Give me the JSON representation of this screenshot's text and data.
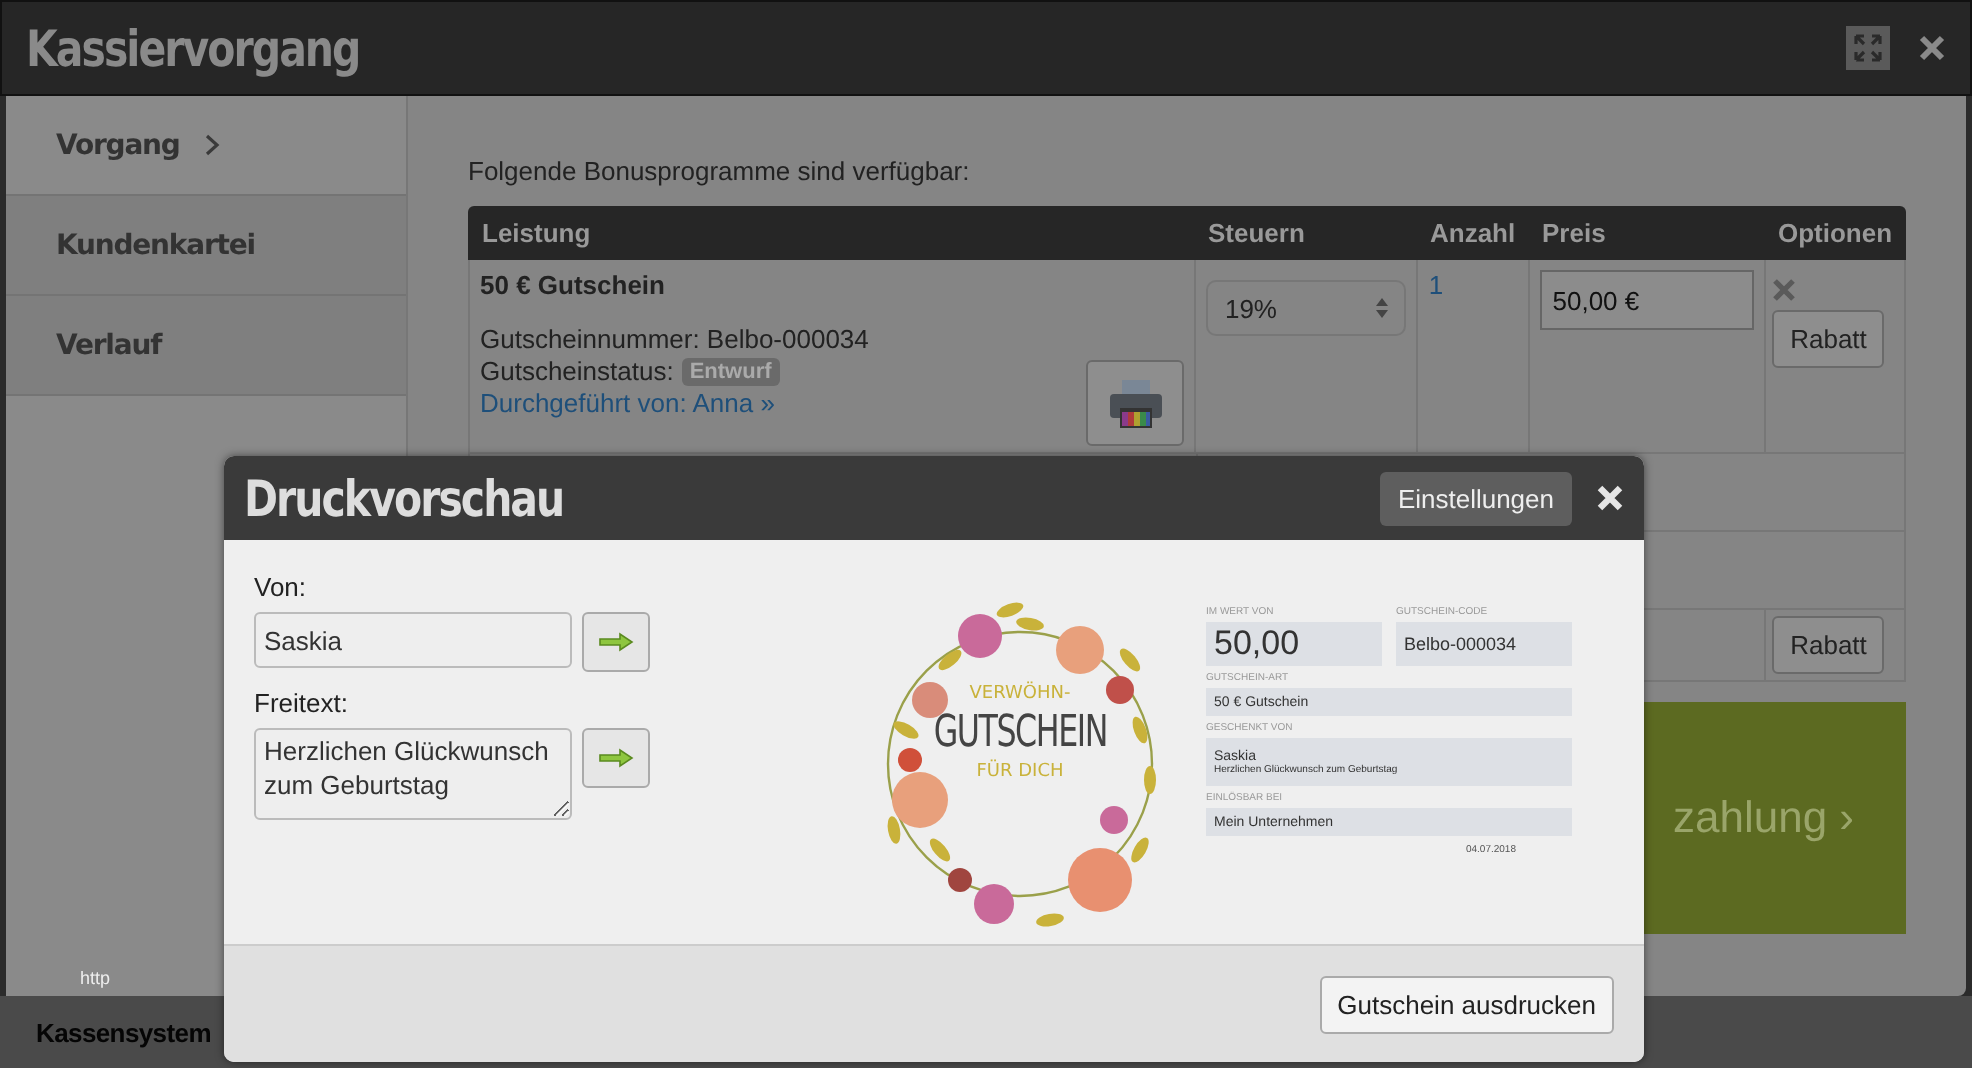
{
  "window": {
    "title": "Kassiervorgang"
  },
  "sidebar": {
    "items": [
      {
        "label": "Vorgang",
        "selected": true
      },
      {
        "label": "Kundenkartei",
        "selected": false
      },
      {
        "label": "Verlauf",
        "selected": false
      }
    ]
  },
  "intro": "Folgende Bonusprogramme sind verfügbar:",
  "table": {
    "columns": [
      "Leistung",
      "Steuern",
      "Anzahl",
      "Preis",
      "Optionen"
    ],
    "rows": [
      {
        "title": "50 € Gutschein",
        "number": "Gutscheinnummer: Belbo-000034",
        "status_label": "Gutscheinstatus:",
        "status": "Entwurf",
        "performed_by": "Durchgeführt von: Anna »",
        "tax": "19%",
        "quantity": "1",
        "price": "50,00 €",
        "discount": "Rabatt"
      },
      {
        "discount": "Rabatt"
      }
    ]
  },
  "pay_button": "zahlung ›",
  "hint": "http",
  "status_bar": "Kassensystem",
  "dialog": {
    "title": "Druckvorschau",
    "settings": "Einstellungen",
    "fields": [
      {
        "kind": "input",
        "label": "Von:",
        "value": "Saskia"
      },
      {
        "kind": "textarea",
        "label": "Freitext:",
        "value": "Herzlichen Glückwunsch zum Geburtstag"
      }
    ],
    "voucher": {
      "top": "VERWÖHN-",
      "main": "GUTSCHEIN",
      "bottom": "FÜR DICH",
      "value_label": "IM WERT VON",
      "value": "50,00",
      "code_label": "GUTSCHEIN-CODE",
      "code": "Belbo-000034",
      "type_label": "GUTSCHEIN-ART",
      "type": "50 € Gutschein",
      "from_label": "GESCHENKT VON",
      "from": "Saskia",
      "message": "Herzlichen Glückwunsch zum Geburtstag",
      "redeem_label": "EINLÖSBAR BEI",
      "redeem": "Mein Unternehmen",
      "date": "04.07.2018"
    },
    "print": "Gutschein ausdrucken"
  }
}
